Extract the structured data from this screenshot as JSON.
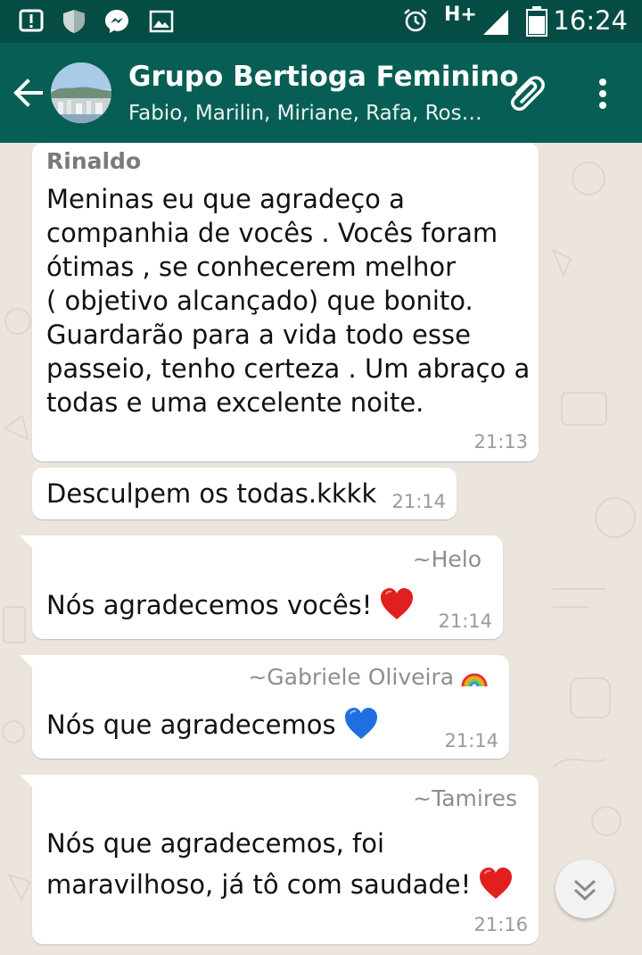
{
  "status_bar": {
    "time": "16:24",
    "network": "H+",
    "icons": [
      "alert-icon",
      "shield-icon",
      "messenger-icon",
      "image-icon",
      "alarm-icon",
      "signal-icon",
      "battery-icon"
    ]
  },
  "header": {
    "title": "Grupo Bertioga Feminino",
    "subtitle": "Fabio, Marilin, Miriane, Rafa, Ros…",
    "colors": {
      "bar": "#075e54",
      "status": "#054d44"
    }
  },
  "messages": [
    {
      "sender": "Rinaldo",
      "lines": [
        "Meninas eu que agradeço a",
        "companhia de vocês . Vocês foram",
        "ótimas , se conhecerem melhor",
        "( objetivo alcançado) que bonito.",
        "Guardarão para a vida todo esse",
        "passeio, tenho certeza . Um abraço a",
        "todas e uma excelente noite."
      ],
      "time": "21:13"
    },
    {
      "sender": "",
      "lines": [
        "Desculpem os todas.kkkk"
      ],
      "time": "21:14"
    },
    {
      "sender": "~Helo",
      "lines": [
        "Nós agradecemos vocês!"
      ],
      "emoji": "red-heart",
      "time": "21:14"
    },
    {
      "sender": "~Gabriele Oliveira",
      "sender_emoji": "rainbow",
      "lines": [
        "Nós que agradecemos"
      ],
      "emoji": "blue-heart",
      "time": "21:14"
    },
    {
      "sender": "~Tamires",
      "lines": [
        "Nós que agradecemos, foi",
        "maravilhoso, já tô com saudade!"
      ],
      "emoji": "red-heart",
      "time": "21:16"
    }
  ]
}
